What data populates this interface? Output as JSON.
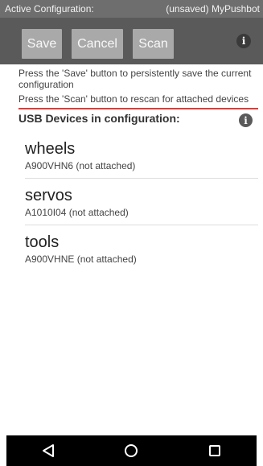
{
  "status_bar": {
    "left_label": "Active Configuration:",
    "right_label": "(unsaved) MyPushbot"
  },
  "toolbar": {
    "save_label": "Save",
    "cancel_label": "Cancel",
    "scan_label": "Scan",
    "info_icon": "info-icon"
  },
  "hints": {
    "save_hint": "Press the 'Save' button to persistently save the current configuration",
    "scan_hint": "Press the 'Scan' button to rescan for attached devices"
  },
  "section": {
    "title": "USB Devices in configuration:",
    "info_icon": "info-icon"
  },
  "devices": [
    {
      "name": "wheels",
      "serial": "A900VHN6 (not attached)"
    },
    {
      "name": "servos",
      "serial": "A1010I04 (not attached)"
    },
    {
      "name": "tools",
      "serial": "A900VHNE (not attached)"
    }
  ],
  "nav": {
    "back_icon": "back-triangle-icon",
    "home_icon": "home-circle-icon",
    "recents_icon": "recents-square-icon"
  },
  "colors": {
    "toolbar_bg": "#5a5a5a",
    "button_bg": "#a9a9a9",
    "accent_line": "#e53935",
    "nav_bg": "#000000"
  }
}
